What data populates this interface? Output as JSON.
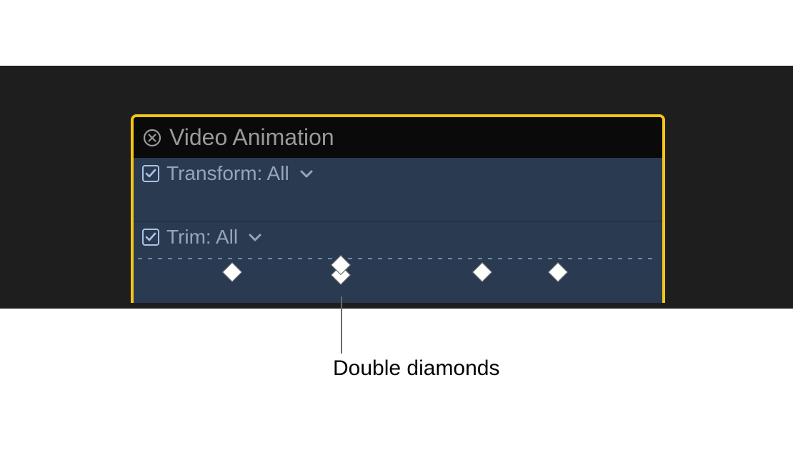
{
  "panel": {
    "title": "Video Animation",
    "rows": [
      {
        "label": "Transform: All",
        "checked": true
      },
      {
        "label": "Trim: All",
        "checked": true
      }
    ],
    "keyframes": {
      "positions": [
        128,
        280,
        478,
        584
      ],
      "double_index": 1
    }
  },
  "annotation": {
    "label": "Double diamonds"
  },
  "colors": {
    "accent": "#f5c518",
    "panel_bg": "#2a3a50",
    "header_bg": "#0a0a0a"
  }
}
